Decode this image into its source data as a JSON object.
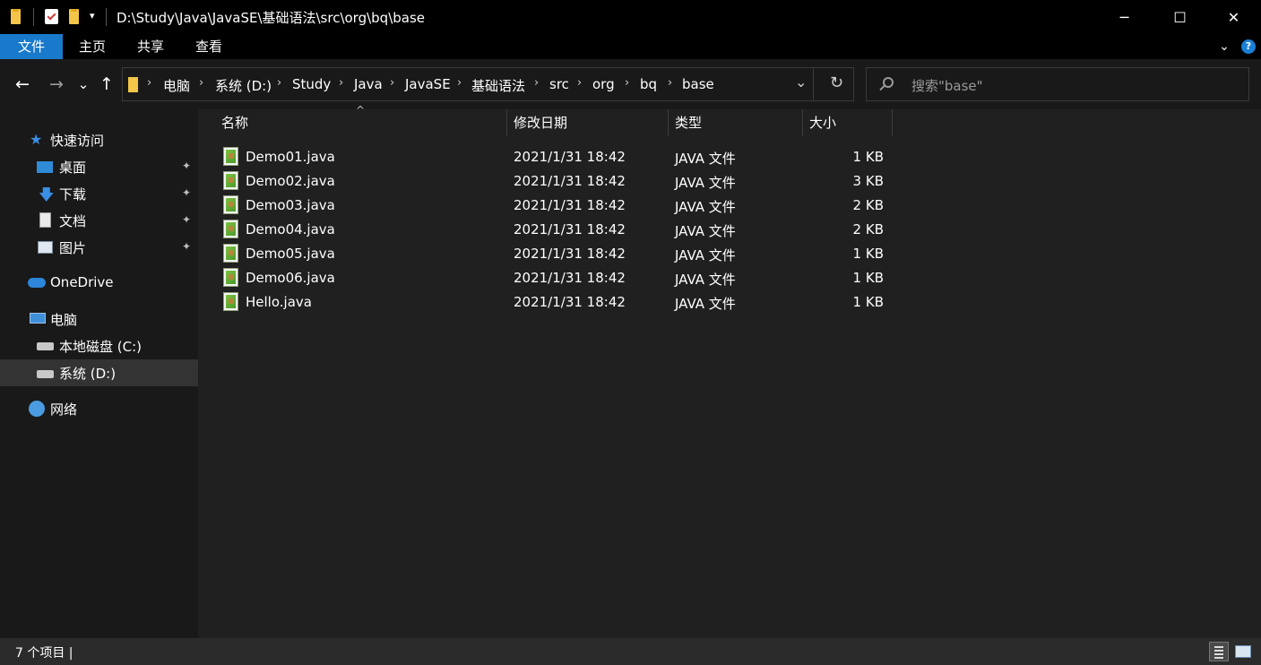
{
  "window": {
    "title": "D:\\Study\\Java\\JavaSE\\基础语法\\src\\org\\bq\\base",
    "minimize": "─",
    "maximize": "☐",
    "close": "✕"
  },
  "ribbon": {
    "tabs": [
      "文件",
      "主页",
      "共享",
      "查看"
    ],
    "help": "?"
  },
  "nav": {
    "back": "←",
    "forward": "→",
    "recent": "⌄",
    "up": "↑"
  },
  "address": {
    "crumbs": [
      "电脑",
      "系统 (D:)",
      "Study",
      "Java",
      "JavaSE",
      "基础语法",
      "src",
      "org",
      "bq",
      "base"
    ],
    "separator": "›",
    "dropdown": "⌄",
    "refresh": "↻"
  },
  "search": {
    "placeholder": "搜索\"base\""
  },
  "sidebar": {
    "quick_access": "快速访问",
    "items": [
      {
        "label": "桌面"
      },
      {
        "label": "下载"
      },
      {
        "label": "文档"
      },
      {
        "label": "图片"
      }
    ],
    "onedrive": "OneDrive",
    "this_pc": "电脑",
    "drives": [
      {
        "label": "本地磁盘 (C:)"
      },
      {
        "label": "系统 (D:)"
      }
    ],
    "network": "网络",
    "pin_glyph": "📌"
  },
  "columns": {
    "name": "名称",
    "modified": "修改日期",
    "type": "类型",
    "size": "大小",
    "sort_indicator": "^"
  },
  "files": [
    {
      "name": "Demo01.java",
      "modified": "2021/1/31 18:42",
      "type": "JAVA 文件",
      "size": "1 KB"
    },
    {
      "name": "Demo02.java",
      "modified": "2021/1/31 18:42",
      "type": "JAVA 文件",
      "size": "3 KB"
    },
    {
      "name": "Demo03.java",
      "modified": "2021/1/31 18:42",
      "type": "JAVA 文件",
      "size": "2 KB"
    },
    {
      "name": "Demo04.java",
      "modified": "2021/1/31 18:42",
      "type": "JAVA 文件",
      "size": "2 KB"
    },
    {
      "name": "Demo05.java",
      "modified": "2021/1/31 18:42",
      "type": "JAVA 文件",
      "size": "1 KB"
    },
    {
      "name": "Demo06.java",
      "modified": "2021/1/31 18:42",
      "type": "JAVA 文件",
      "size": "1 KB"
    },
    {
      "name": "Hello.java",
      "modified": "2021/1/31 18:42",
      "type": "JAVA 文件",
      "size": "1 KB"
    }
  ],
  "status": {
    "text": "7 个项目  |"
  },
  "colors": {
    "accent": "#1979ca",
    "titlebar": "#000000",
    "content_bg": "#202020",
    "sidebar_bg": "#191919",
    "selected_nav": "#333333"
  }
}
